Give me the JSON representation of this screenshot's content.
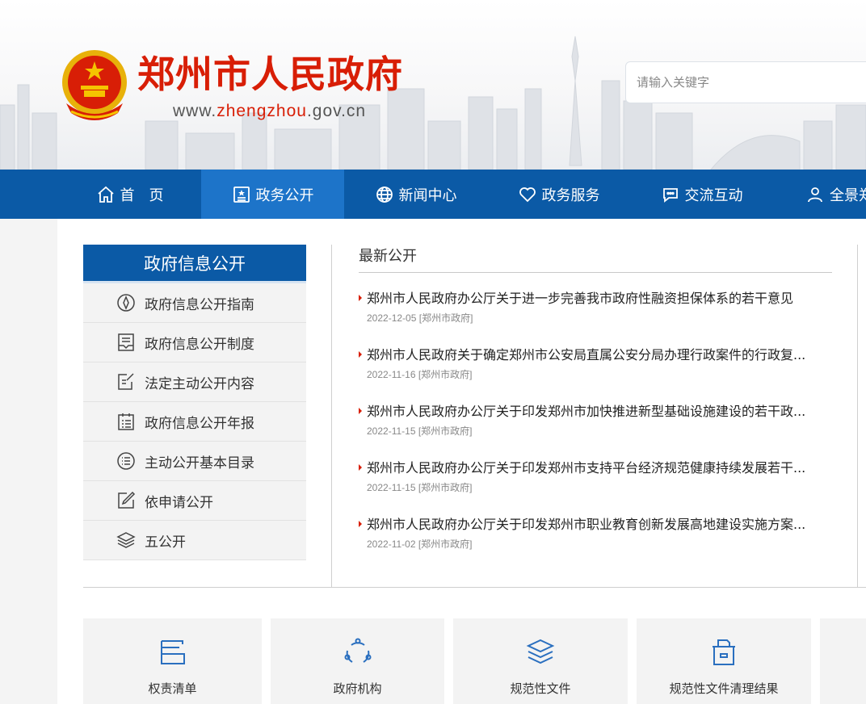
{
  "header": {
    "title": "郑州市人民政府",
    "url_prefix": "www.",
    "url_highlight": "zhengzhou",
    "url_suffix": ".gov.cn",
    "search_placeholder": "请输入关键字"
  },
  "nav": {
    "items": [
      {
        "label": "首　页",
        "icon": "home-icon"
      },
      {
        "label": "政务公开",
        "icon": "document-icon",
        "active": true
      },
      {
        "label": "新闻中心",
        "icon": "globe-icon"
      },
      {
        "label": "政务服务",
        "icon": "heart-icon"
      },
      {
        "label": "交流互动",
        "icon": "chat-icon"
      },
      {
        "label": "全景郑",
        "icon": "user-icon"
      }
    ]
  },
  "sidebar": {
    "title": "政府信息公开",
    "items": [
      {
        "label": "政府信息公开指南",
        "icon": "compass-icon"
      },
      {
        "label": "政府信息公开制度",
        "icon": "inbox-icon"
      },
      {
        "label": "法定主动公开内容",
        "icon": "edit-icon"
      },
      {
        "label": "政府信息公开年报",
        "icon": "report-icon"
      },
      {
        "label": "主动公开基本目录",
        "icon": "list-icon"
      },
      {
        "label": "依申请公开",
        "icon": "pen-icon"
      },
      {
        "label": "五公开",
        "icon": "layers-icon"
      }
    ]
  },
  "news": {
    "title": "最新公开",
    "items": [
      {
        "title": "郑州市人民政府办公厅关于进一步完善我市政府性融资担保体系的若干意见",
        "date": "2022-12-05",
        "source": "[郑州市政府]"
      },
      {
        "title": "郑州市人民政府关于确定郑州市公安局直属公安分局办理行政案件的行政复...",
        "date": "2022-11-16",
        "source": "[郑州市政府]"
      },
      {
        "title": "郑州市人民政府办公厅关于印发郑州市加快推进新型基础设施建设的若干政...",
        "date": "2022-11-15",
        "source": "[郑州市政府]"
      },
      {
        "title": "郑州市人民政府办公厅关于印发郑州市支持平台经济规范健康持续发展若干...",
        "date": "2022-11-15",
        "source": "[郑州市政府]"
      },
      {
        "title": "郑州市人民政府办公厅关于印发郑州市职业教育创新发展高地建设实施方案...",
        "date": "2022-11-02",
        "source": "[郑州市政府]"
      }
    ]
  },
  "tiles": [
    {
      "label": "权责清单",
      "icon": "checklist-icon"
    },
    {
      "label": "政府机构",
      "icon": "org-cycle-icon"
    },
    {
      "label": "规范性文件",
      "icon": "stack-icon"
    },
    {
      "label": "规范性文件清理结果",
      "icon": "archive-icon"
    }
  ],
  "colors": {
    "brand_red": "#d81e06",
    "nav_blue": "#0b5aa6",
    "nav_active": "#1d74c9",
    "icon_blue": "#2a6fbf"
  }
}
